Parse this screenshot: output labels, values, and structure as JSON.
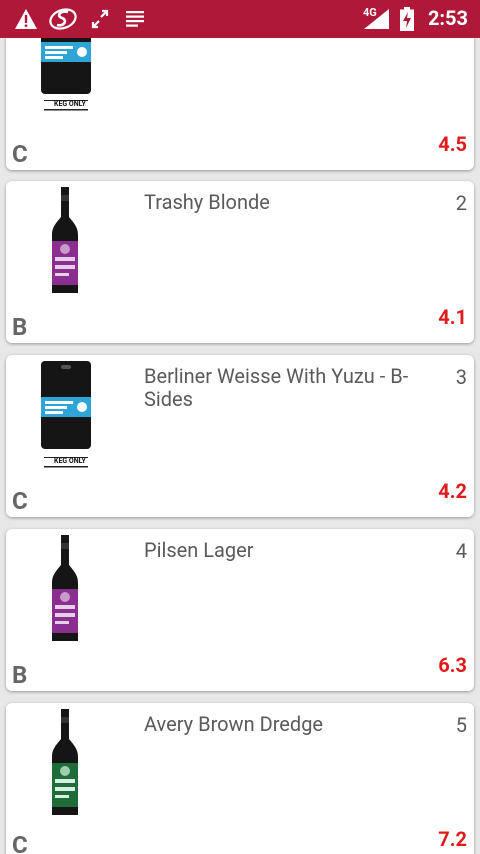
{
  "status_bar": {
    "time": "2:53",
    "network": "4G",
    "icons": [
      "warning-icon",
      "app-s-icon",
      "sync-icon",
      "notes-icon",
      "signal-icon",
      "battery-charging-icon"
    ]
  },
  "beers": [
    {
      "rank": "",
      "name": "",
      "grade": "C",
      "score": "4.5",
      "image": "keg-icon",
      "image_label": "KEG ONLY"
    },
    {
      "rank": "2",
      "name": "Trashy Blonde",
      "grade": "B",
      "score": "4.1",
      "image": "bottle-icon",
      "bottle_color": "#8a2e8f"
    },
    {
      "rank": "3",
      "name": "Berliner Weisse With Yuzu - B-Sides",
      "grade": "C",
      "score": "4.2",
      "image": "keg-icon",
      "image_label": "KEG ONLY"
    },
    {
      "rank": "4",
      "name": "Pilsen Lager",
      "grade": "B",
      "score": "6.3",
      "image": "bottle-icon",
      "bottle_color": "#8a2e8f"
    },
    {
      "rank": "5",
      "name": "Avery Brown Dredge",
      "grade": "C",
      "score": "7.2",
      "image": "bottle-icon",
      "bottle_color": "#1f6b3a"
    }
  ],
  "colors": {
    "status_bar": "#b0183a",
    "score": "#e01b1b",
    "keg_label": "#2ea5d6"
  }
}
